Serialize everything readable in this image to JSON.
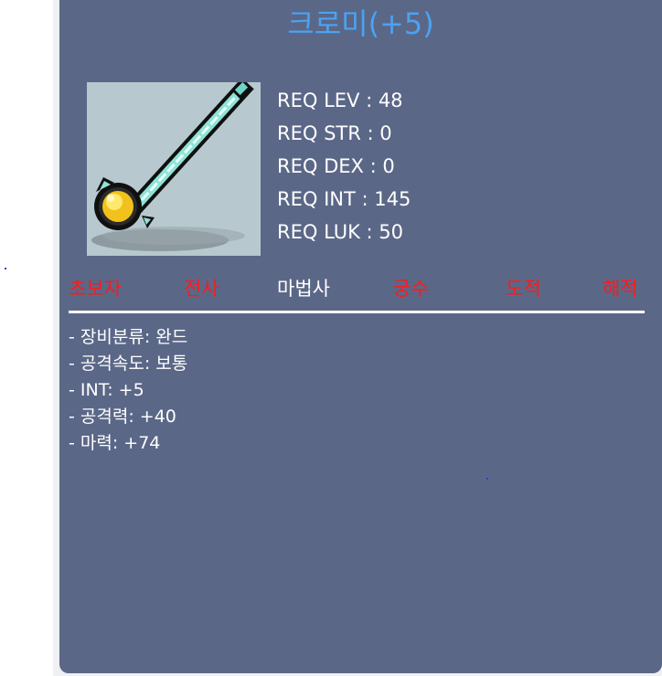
{
  "item": {
    "name": "크로미(+5)",
    "icon": "wand-icon"
  },
  "requirements": [
    {
      "label": "REQ LEV",
      "value": "48",
      "text": "REQ LEV : 48"
    },
    {
      "label": "REQ STR",
      "value": "0",
      "text": "REQ STR : 0"
    },
    {
      "label": "REQ DEX",
      "value": "0",
      "text": "REQ DEX : 0"
    },
    {
      "label": "REQ INT",
      "value": "145",
      "text": "REQ INT : 145"
    },
    {
      "label": "REQ LUK",
      "value": "50",
      "text": "REQ LUK : 50"
    }
  ],
  "classes": [
    {
      "name": "초보자",
      "available": false
    },
    {
      "name": "전사",
      "available": false
    },
    {
      "name": "마법사",
      "available": true
    },
    {
      "name": "궁수",
      "available": false
    },
    {
      "name": "도적",
      "available": false
    },
    {
      "name": "해적",
      "available": false
    }
  ],
  "stats": [
    "- 장비분류: 완드",
    "- 공격속도: 보통",
    "- INT: +5",
    "- 공격력: +40",
    "- 마력: +74"
  ],
  "colors": {
    "panel": "#5b6787",
    "title": "#4aa3f2",
    "unavailable_class": "#ff1a1a",
    "available_class": "#ffffff",
    "icon_background": "#b7c9cf"
  }
}
